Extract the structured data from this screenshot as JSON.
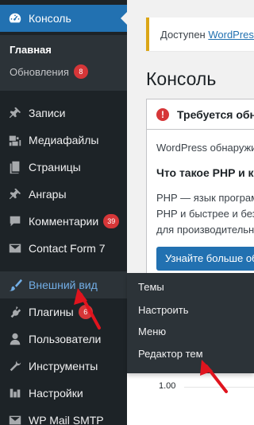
{
  "notice": {
    "prefix": "Доступен ",
    "link": "WordPress"
  },
  "page_title": "Консоль",
  "php_box": {
    "heading": "Требуется обнo",
    "line1": "WordPress обнаружи",
    "subheading": "Что такое PHP и ка",
    "para": [
      "PHP — язык програм",
      "PHP и быстрее и безо",
      "для производительно"
    ],
    "button": "Узнайте больше об"
  },
  "sidebar": {
    "console": "Консоль",
    "sub": {
      "home": "Главная",
      "updates": "Обновления",
      "updates_badge": "8"
    },
    "items": [
      {
        "label": "Записи",
        "icon": "pin-icon"
      },
      {
        "label": "Медиафайлы",
        "icon": "media-icon"
      },
      {
        "label": "Страницы",
        "icon": "pages-icon"
      },
      {
        "label": "Ангары",
        "icon": "pin-icon"
      },
      {
        "label": "Комментарии",
        "icon": "comment-icon",
        "badge": "39"
      },
      {
        "label": "Contact Form 7",
        "icon": "mail-icon"
      },
      {
        "label": "Внешний вид",
        "icon": "brush-icon"
      },
      {
        "label": "Плагины",
        "icon": "plugin-icon",
        "badge": "6"
      },
      {
        "label": "Пользователи",
        "icon": "user-icon"
      },
      {
        "label": "Инструменты",
        "icon": "wrench-icon"
      },
      {
        "label": "Настройки",
        "icon": "settings-icon"
      },
      {
        "label": "WP Mail SMTP",
        "icon": "mail-icon"
      }
    ]
  },
  "flyout": [
    "Темы",
    "Настроить",
    "Меню",
    "Редактор тем"
  ],
  "chart": {
    "tick": "1.00"
  },
  "colors": {
    "accent": "#2271b1",
    "sidebar": "#1d2327",
    "badge": "#d63638",
    "arrow": "#e0141e"
  }
}
